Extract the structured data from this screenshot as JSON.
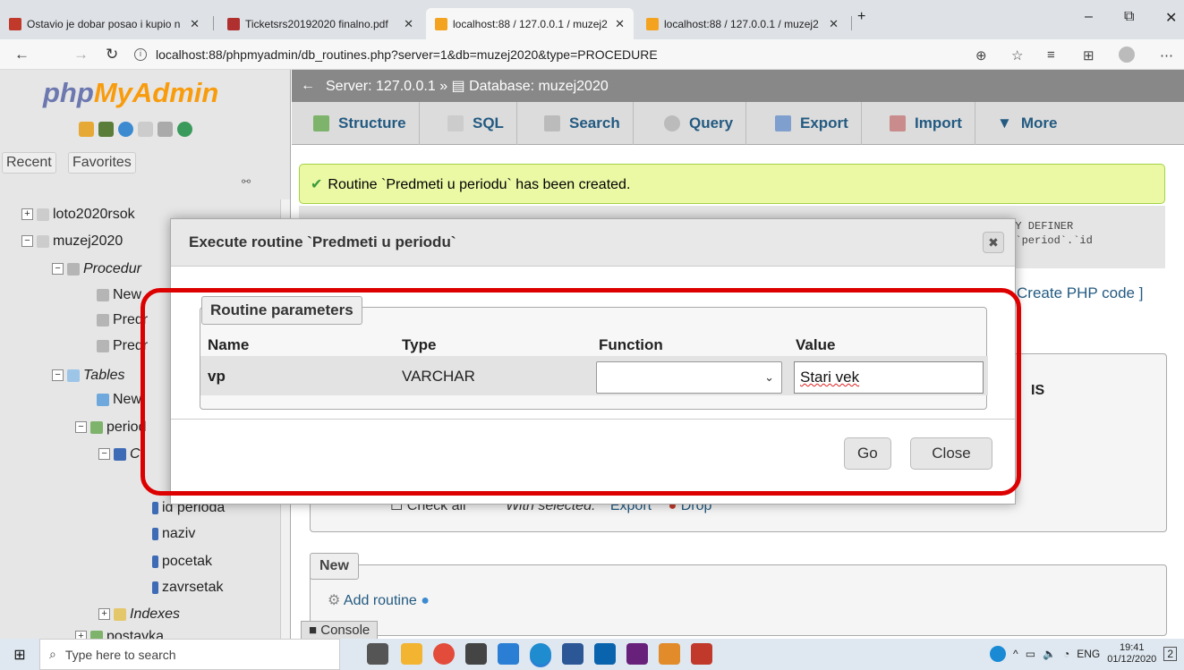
{
  "browser": {
    "tabs": [
      {
        "label": "Ostavio je dobar posao i kupio n",
        "color": "#c0392b"
      },
      {
        "label": "Ticketsrs20192020 finalno.pdf",
        "color": "#b03030"
      },
      {
        "label": "localhost:88 / 127.0.0.1 / muzej2",
        "color": "#f4a321"
      },
      {
        "label": "localhost:88 / 127.0.0.1 / muzej2",
        "color": "#f4a321"
      }
    ],
    "url": "localhost:88/phpmyadmin/db_routines.php?server=1&db=muzej2020&type=PROCEDURE",
    "new_tab": "+",
    "win": {
      "min": "–",
      "max": "⧉",
      "close": "✕"
    }
  },
  "sidebar": {
    "logo_a": "php",
    "logo_b": "MyAdmin",
    "tab_recent": "Recent",
    "tab_favorites": "Favorites",
    "tree": [
      "loto2020rsok",
      "muzej2020",
      "Procedur",
      "New",
      "Predr",
      "Predr",
      "Tables",
      "New",
      "period",
      "C",
      "id perioda",
      "naziv",
      "pocetak",
      "zavrsetak",
      "Indexes",
      "postavka"
    ]
  },
  "main": {
    "breadcrumb": "Server: 127.0.0.1 » ▤ Database: muzej2020",
    "tabs": [
      "Structure",
      "SQL",
      "Search",
      "Query",
      "Export",
      "Import",
      "More"
    ],
    "success": "Routine `Predmeti u periodu` has been created.",
    "sql_line1": "ITY DEFINER",
    "sql_line2": "l `period`.`id",
    "php_link": "Create PHP code ]",
    "peek_s": "IS",
    "check_all": "Check all",
    "with_selected": "With selected:",
    "export": "Export",
    "drop": "Drop",
    "new_legend": "New",
    "add_routine": "Add routine",
    "console": "Console"
  },
  "dialog": {
    "title": "Execute routine `Predmeti u periodu`",
    "close": "✖",
    "legend": "Routine parameters",
    "headers": {
      "name": "Name",
      "type": "Type",
      "function": "Function",
      "value": "Value"
    },
    "row": {
      "name": "vp",
      "type": "VARCHAR",
      "function": "",
      "value": "Stari vek"
    },
    "go": "Go",
    "close_btn": "Close"
  },
  "taskbar": {
    "search_placeholder": "Type here to search",
    "lang": "ENG",
    "time": "19:41",
    "date": "01/12/2020",
    "notif": "2"
  }
}
